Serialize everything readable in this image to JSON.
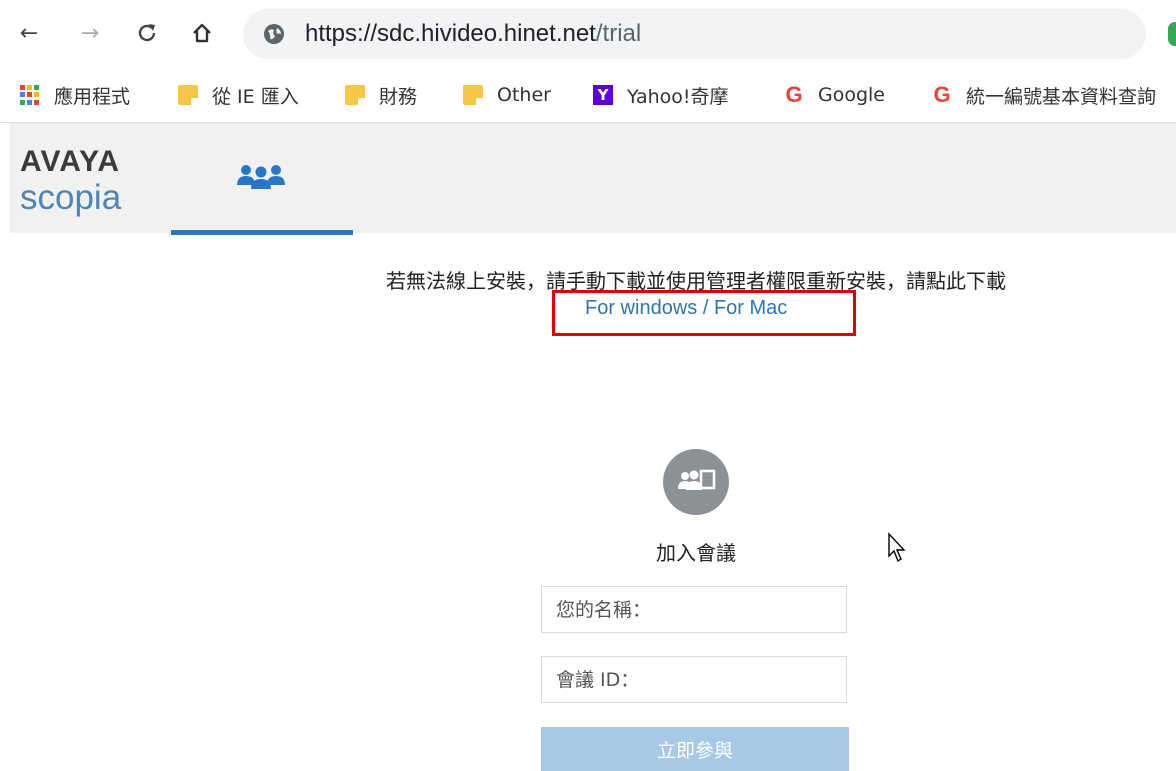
{
  "browser": {
    "url_scheme_host": "https://sdc.hivideo.hinet.net",
    "url_path": "/trial",
    "back_icon": "arrow-left",
    "forward_icon": "arrow-right",
    "reload_icon": "reload",
    "home_icon": "home"
  },
  "bookmarks": [
    {
      "label": "應用程式",
      "icon": "apps-grid"
    },
    {
      "label": "從 IE 匯入",
      "icon": "folder"
    },
    {
      "label": "財務",
      "icon": "folder"
    },
    {
      "label": "Other",
      "icon": "folder"
    },
    {
      "label": "Yahoo!奇摩",
      "icon": "yahoo-logo"
    },
    {
      "label": "Google",
      "icon": "google-logo"
    },
    {
      "label": "統一編號基本資料查詢",
      "icon": "google-logo"
    }
  ],
  "app": {
    "logo_line1": "AVAYA",
    "logo_line2": "scopia",
    "accent_color": "#2a76c6"
  },
  "notice": {
    "text": "若無法線上安裝，請手動下載並使用管理者權限重新安裝，請點此下載",
    "windows_link": "For windows",
    "separator": " / ",
    "mac_link": "For Mac"
  },
  "join": {
    "title": "加入會議",
    "name_placeholder": "您的名稱：",
    "id_placeholder": "會議 ID：",
    "button_label": "立即參與"
  }
}
